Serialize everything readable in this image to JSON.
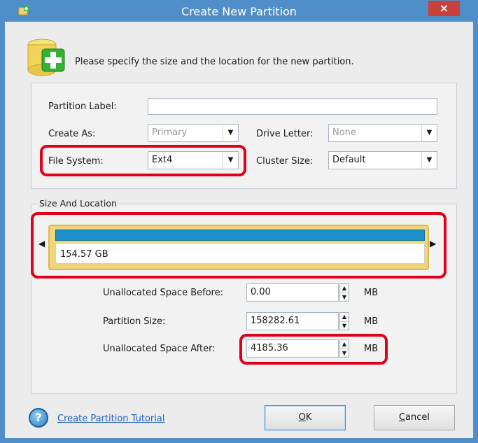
{
  "window": {
    "title": "Create New Partition",
    "close_symbol": "×"
  },
  "header": {
    "instruction": "Please specify the size and the location for the new partition."
  },
  "form": {
    "partition_label": {
      "label": "Partition Label:",
      "value": ""
    },
    "create_as": {
      "label": "Create As:",
      "value": "Primary"
    },
    "drive_letter": {
      "label": "Drive Letter:",
      "value": "None"
    },
    "file_system": {
      "label": "File System:",
      "value": "Ext4"
    },
    "cluster_size": {
      "label": "Cluster Size:",
      "value": "Default"
    }
  },
  "size_location": {
    "group_label": "Size And Location",
    "disk_size_text": "154.57 GB",
    "fields": [
      {
        "label": "Unallocated Space Before:",
        "value": "0.00",
        "unit": "MB"
      },
      {
        "label": "Partition Size:",
        "value": "158282.61",
        "unit": "MB"
      },
      {
        "label": "Unallocated Space After:",
        "value": "4185.36",
        "unit": "MB"
      }
    ]
  },
  "footer": {
    "help_link": "Create Partition Tutorial",
    "ok_label_prefix": "",
    "ok_accel": "O",
    "ok_label_rest": "K",
    "cancel_accel": "C",
    "cancel_label_rest": "ancel"
  },
  "colors": {
    "title_bar": "#4f8ec9",
    "close_button": "#c7403a",
    "highlight_border": "#e0001a",
    "disk_bar": "#1b8fc9",
    "disk_frame": "#f0d67a"
  },
  "icons": [
    "app-icon",
    "close-icon",
    "add-partition-icon",
    "dropdown-arrow-icon",
    "spin-up-icon",
    "spin-down-icon",
    "scroll-left-icon",
    "scroll-right-icon",
    "help-icon"
  ]
}
